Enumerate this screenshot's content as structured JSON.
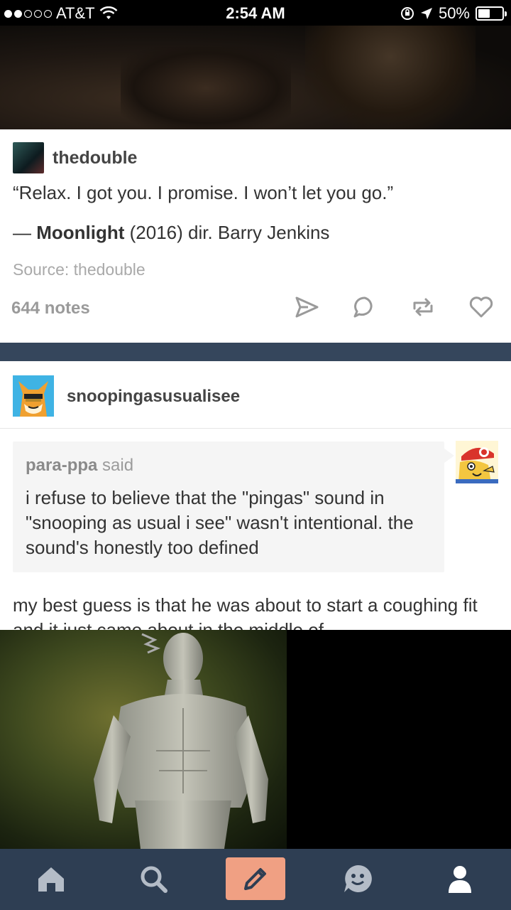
{
  "status_bar": {
    "carrier": "AT&T",
    "time": "2:54 AM",
    "battery": "50%",
    "battery_level": 0.5,
    "signal_bars_filled": 2,
    "signal_bars_total": 5
  },
  "post1": {
    "blog_name": "thedouble",
    "quote": "“Relax. I got you. I promise. I won’t let you go.”",
    "attribution_dash": "— ",
    "attribution_title": "Moonlight",
    "attribution_rest": " (2016) dir. Barry Jenkins",
    "source": "Source: thedouble",
    "notes": "644 notes",
    "actions": [
      "share-icon",
      "reply-icon",
      "reblog-icon",
      "like-icon"
    ]
  },
  "post2": {
    "blog_name": "snoopingasusualisee",
    "reblog_user": "para-ppa",
    "reblog_said": " said",
    "reblog_text": "i refuse to believe that the \"pingas\" sound in \"snooping as usual i see\" wasn't intentional. the sound's honestly too defined",
    "body": "my best guess is that he was about to start a coughing fit and it just came about in the middle of"
  },
  "tab_bar": {
    "tabs": [
      "home-icon",
      "search-icon",
      "compose-icon",
      "activity-icon",
      "account-icon"
    ]
  },
  "colors": {
    "nav_bg": "#2e3e53",
    "separator": "#35465c",
    "compose_bg": "#f0a083"
  }
}
